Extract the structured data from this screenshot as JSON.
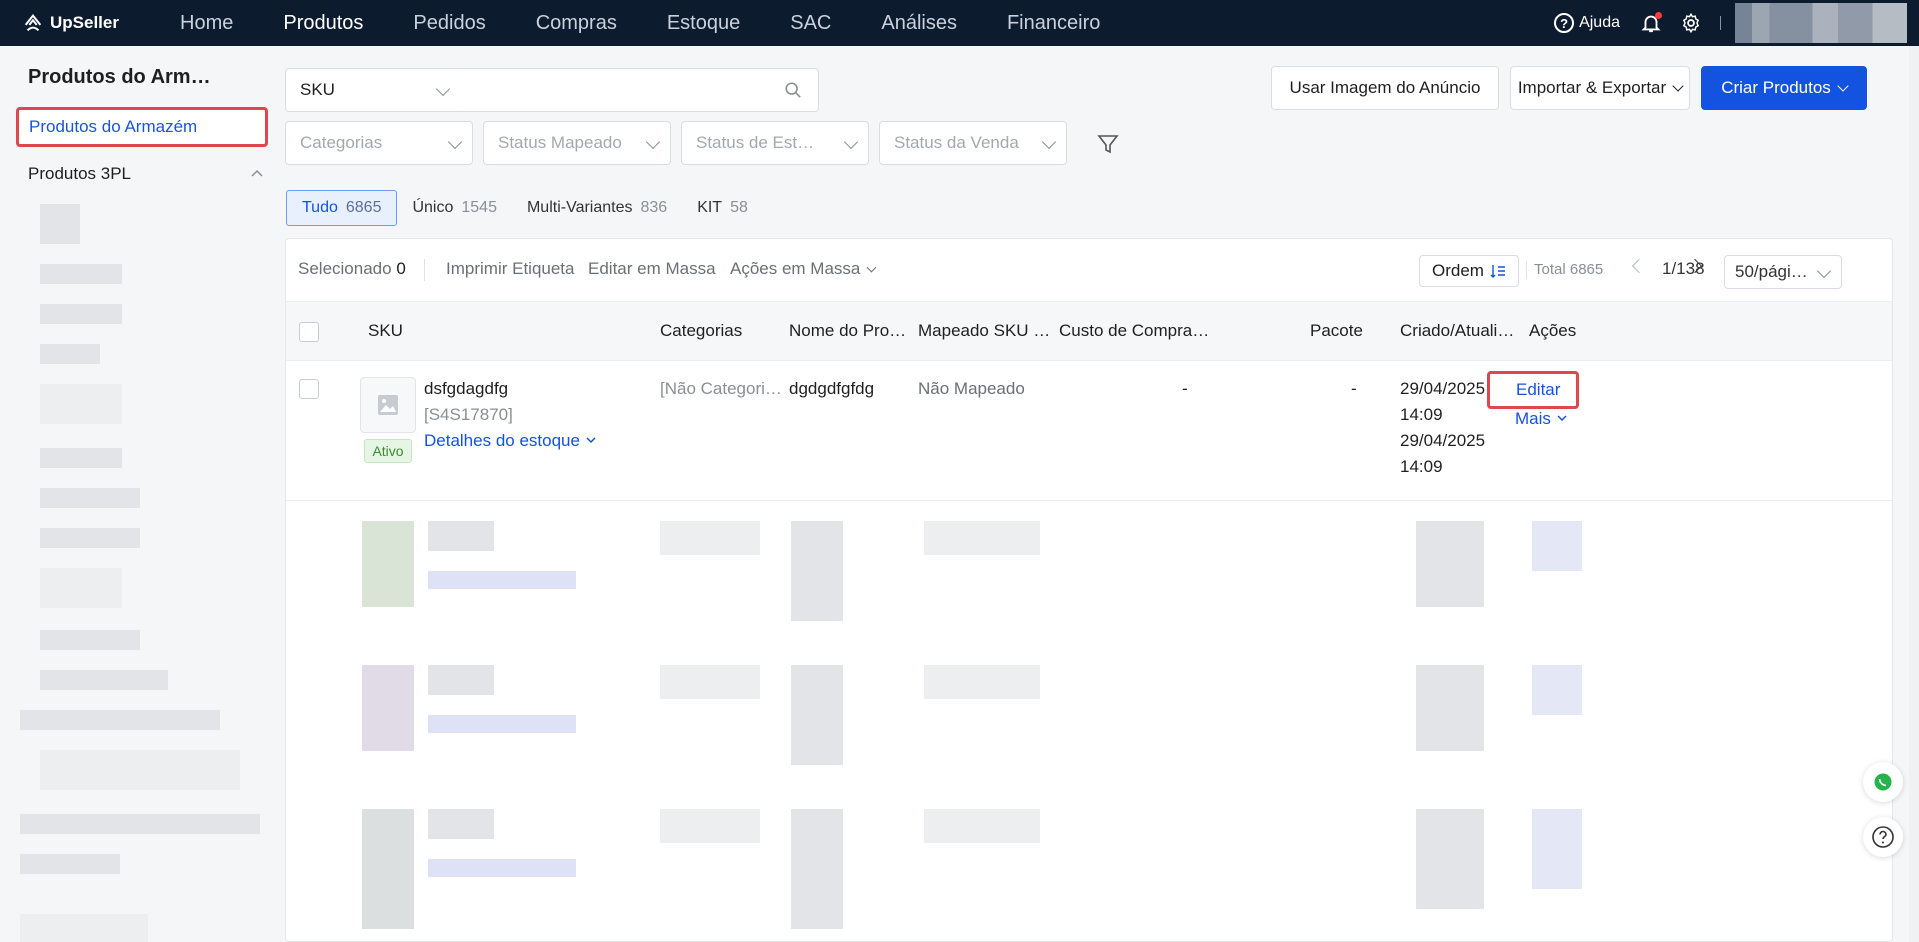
{
  "app": {
    "logo_text": "UpSeller"
  },
  "topnav": {
    "items": [
      "Home",
      "Produtos",
      "Pedidos",
      "Compras",
      "Estoque",
      "SAC",
      "Análises",
      "Financeiro"
    ],
    "active": "Produtos",
    "help_label": "Ajuda"
  },
  "sidebar": {
    "title": "Produtos do Arm…",
    "active_item": "Produtos do Armazém",
    "group_label": "Produtos 3PL"
  },
  "filters": {
    "search_type": "SKU",
    "search_value": "",
    "categorias": "Categorias",
    "status_mapeado": "Status Mapeado",
    "status_estoque": "Status de Est…",
    "status_venda": "Status da Venda"
  },
  "actions": {
    "usar_imagem": "Usar Imagem do Anúncio",
    "importar_exportar": "Importar & Exportar",
    "criar_produtos": "Criar Produtos"
  },
  "tabs": [
    {
      "label": "Tudo",
      "count": "6865"
    },
    {
      "label": "Único",
      "count": "1545"
    },
    {
      "label": "Multi-Variantes",
      "count": "836"
    },
    {
      "label": "KIT",
      "count": "58"
    }
  ],
  "toolbar": {
    "selected_label": "Selecionado",
    "selected_count": "0",
    "imprimir": "Imprimir Etiqueta",
    "editar_massa": "Editar em Massa",
    "acoes_massa": "Ações em Massa",
    "ordem": "Ordem",
    "total": "Total 6865",
    "page": "1/138",
    "page_size": "50/pági…"
  },
  "table": {
    "headers": [
      "SKU",
      "Categorias",
      "Nome do Pro…",
      "Mapeado SKU …",
      "Custo de Compra…",
      "Pacote",
      "Criado/Atuali…",
      "Ações"
    ],
    "row": {
      "sku": "dsfgdagdfg",
      "sku_code": "[S4S17870]",
      "status": "Ativo",
      "details_link": "Detalhes do estoque",
      "categoria": "[Não Categori…",
      "nome": "dgdgdfgfdg",
      "mapeado": "Não Mapeado",
      "custo": "-",
      "pacote": "-",
      "criado_date": "29/04/2025",
      "criado_time": "14:09",
      "atualizado_date": "29/04/2025",
      "atualizado_time": "14:09",
      "editar": "Editar",
      "mais": "Mais"
    }
  },
  "colors": {
    "nav_bg": "#0d1b2e",
    "primary": "#1452e0",
    "highlight_border": "#e0474c",
    "active_badge": "#3b8a33"
  }
}
